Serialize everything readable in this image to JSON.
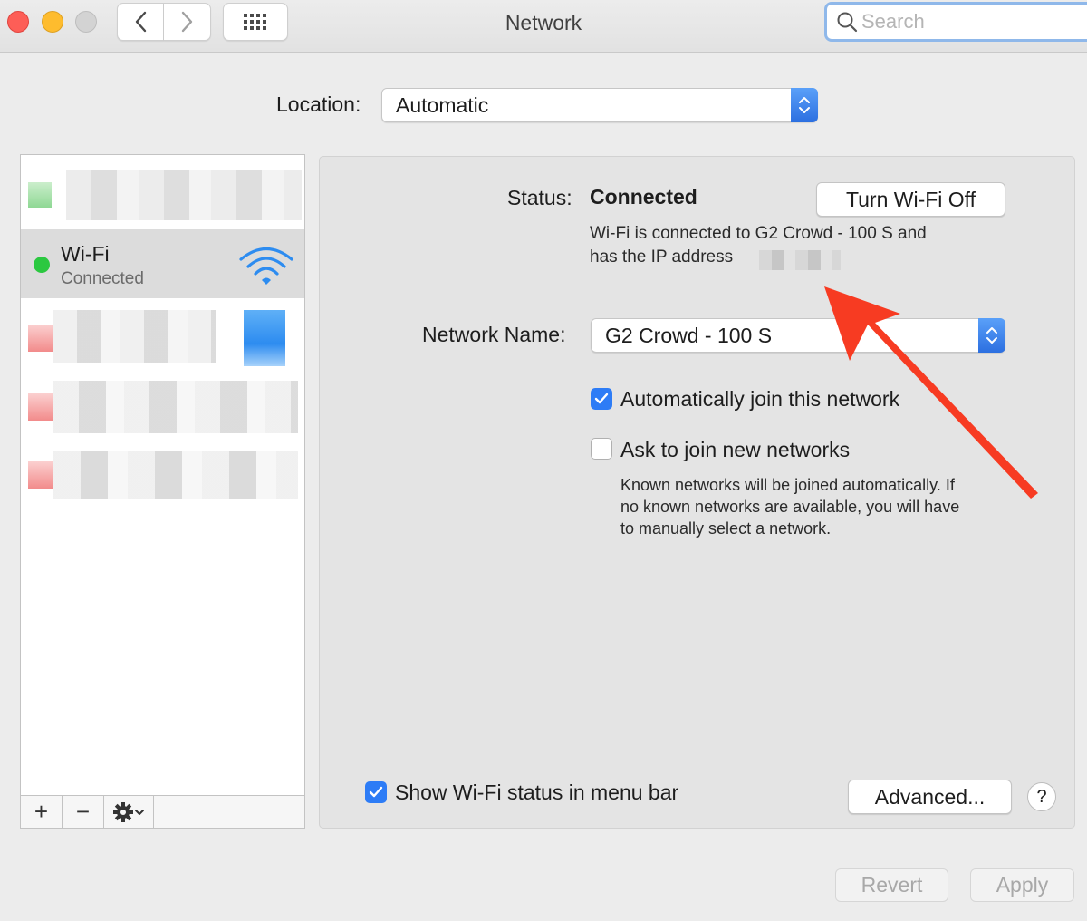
{
  "window": {
    "title": "Network",
    "search_placeholder": "Search"
  },
  "location": {
    "label": "Location:",
    "value": "Automatic"
  },
  "services": [
    {
      "name": "",
      "status": "",
      "dot_color": "#9fe0a4",
      "blurred": true
    },
    {
      "name": "Wi-Fi",
      "status": "Connected",
      "dot_color": "#2bc840",
      "selected": true,
      "icon": "wifi-icon"
    },
    {
      "name": "",
      "status": "",
      "dot_color": "#f4a3a3",
      "blurred": true
    },
    {
      "name": "",
      "status": "",
      "dot_color": "#f4a3a3",
      "blurred": true
    },
    {
      "name": "",
      "status": "",
      "dot_color": "#f4a3a3",
      "blurred": true
    }
  ],
  "list_toolbar": {
    "add": "+",
    "remove": "−",
    "gear_icon": "gear-icon"
  },
  "detail": {
    "status_label": "Status:",
    "status_value": "Connected",
    "toggle_button": "Turn Wi-Fi Off",
    "status_desc_line1": "Wi-Fi is connected to G2 Crowd - 100 S and",
    "status_desc_line2": "has the IP address",
    "network_name_label": "Network Name:",
    "network_name_value": "G2 Crowd - 100 S",
    "auto_join_label": "Automatically join this network",
    "auto_join_checked": true,
    "ask_join_label": "Ask to join new networks",
    "ask_join_checked": false,
    "ask_join_desc": [
      "Known networks will be joined automatically. If",
      "no known networks are available, you will have",
      "to manually select a network."
    ],
    "show_status_label": "Show Wi-Fi status in menu bar",
    "show_status_checked": true,
    "advanced_button": "Advanced...",
    "help": "?"
  },
  "footer": {
    "revert": "Revert",
    "apply": "Apply"
  },
  "colors": {
    "accent": "#2d7cf6",
    "annotation_arrow": "#f73b22"
  }
}
